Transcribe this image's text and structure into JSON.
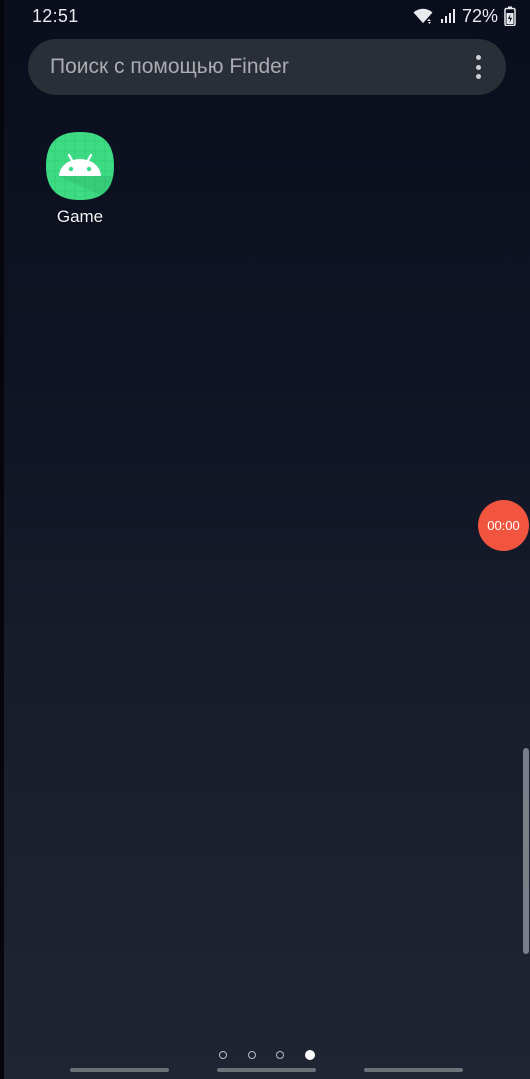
{
  "status_bar": {
    "time": "12:51",
    "battery_percent": "72%",
    "icons": [
      "wifi-icon",
      "signal-icon",
      "battery-icon"
    ]
  },
  "search": {
    "placeholder": "Поиск с помощью Finder",
    "menu_icon": "more-vert-icon"
  },
  "apps": [
    {
      "label": "Game",
      "icon": "android-icon",
      "color": "#3ddc84"
    }
  ],
  "recording": {
    "timer": "00:00",
    "color": "#f2553f"
  },
  "page_indicator": {
    "total": 4,
    "active_index": 3
  },
  "colors": {
    "search_bg": "#2a2e37",
    "wallpaper_top": "#0a0e1c",
    "wallpaper_bottom": "#1f2532"
  }
}
